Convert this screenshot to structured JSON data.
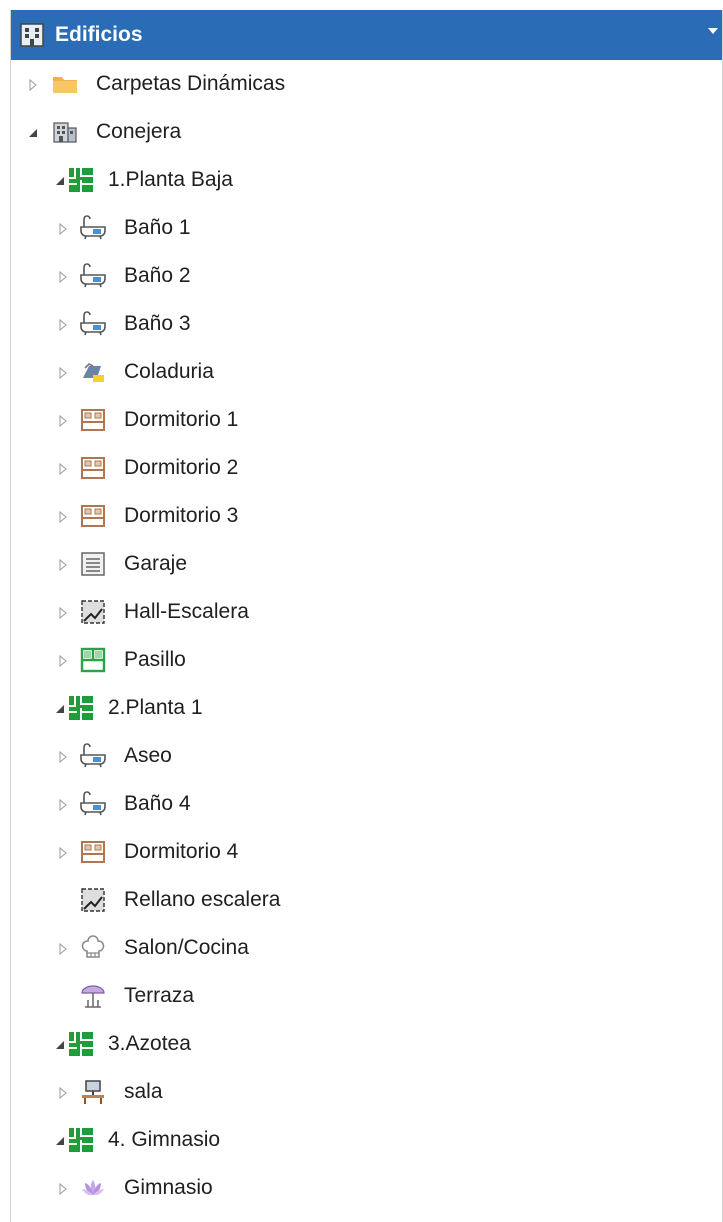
{
  "panel": {
    "title": "Edificios",
    "header_icon": "building-icon",
    "accent": "#2a6cb6"
  },
  "tree": [
    {
      "label": "Carpetas Dinámicas",
      "level": 0,
      "expander": "collapsed",
      "icon": "folder-icon"
    },
    {
      "label": "Conejera",
      "level": 0,
      "expander": "expanded",
      "icon": "building-icon"
    },
    {
      "label": "1.Planta Baja",
      "level": 1,
      "expander": "expanded",
      "icon": "floor-plan-icon"
    },
    {
      "label": "Baño 1",
      "level": 2,
      "expander": "collapsed",
      "icon": "bathtub-icon"
    },
    {
      "label": "Baño 2",
      "level": 2,
      "expander": "collapsed",
      "icon": "bathtub-icon"
    },
    {
      "label": "Baño 3",
      "level": 2,
      "expander": "collapsed",
      "icon": "bathtub-icon"
    },
    {
      "label": "Coladuria",
      "level": 2,
      "expander": "collapsed",
      "icon": "laundry-icon"
    },
    {
      "label": "Dormitorio 1",
      "level": 2,
      "expander": "collapsed",
      "icon": "bed-icon"
    },
    {
      "label": "Dormitorio 2",
      "level": 2,
      "expander": "collapsed",
      "icon": "bed-icon"
    },
    {
      "label": "Dormitorio 3",
      "level": 2,
      "expander": "collapsed",
      "icon": "bed-icon"
    },
    {
      "label": "Garaje",
      "level": 2,
      "expander": "collapsed",
      "icon": "garage-icon"
    },
    {
      "label": "Hall-Escalera",
      "level": 2,
      "expander": "collapsed",
      "icon": "stairs-icon"
    },
    {
      "label": "Pasillo",
      "level": 2,
      "expander": "collapsed",
      "icon": "hallway-icon"
    },
    {
      "label": "2.Planta 1",
      "level": 1,
      "expander": "expanded",
      "icon": "floor-plan-icon"
    },
    {
      "label": "Aseo",
      "level": 2,
      "expander": "collapsed",
      "icon": "bathtub-icon"
    },
    {
      "label": "Baño 4",
      "level": 2,
      "expander": "collapsed",
      "icon": "bathtub-icon"
    },
    {
      "label": "Dormitorio 4",
      "level": 2,
      "expander": "collapsed",
      "icon": "bed-icon"
    },
    {
      "label": "Rellano escalera",
      "level": 2,
      "expander": "none",
      "icon": "stairs-icon"
    },
    {
      "label": "Salon/Cocina",
      "level": 2,
      "expander": "collapsed",
      "icon": "chef-hat-icon"
    },
    {
      "label": "Terraza",
      "level": 2,
      "expander": "none",
      "icon": "umbrella-icon"
    },
    {
      "label": "3.Azotea",
      "level": 1,
      "expander": "expanded",
      "icon": "floor-plan-icon"
    },
    {
      "label": "sala",
      "level": 2,
      "expander": "collapsed",
      "icon": "computer-desk-icon"
    },
    {
      "label": "4. Gimnasio",
      "level": 1,
      "expander": "expanded",
      "icon": "floor-plan-icon"
    },
    {
      "label": "Gimnasio",
      "level": 2,
      "expander": "collapsed",
      "icon": "lotus-icon"
    }
  ]
}
